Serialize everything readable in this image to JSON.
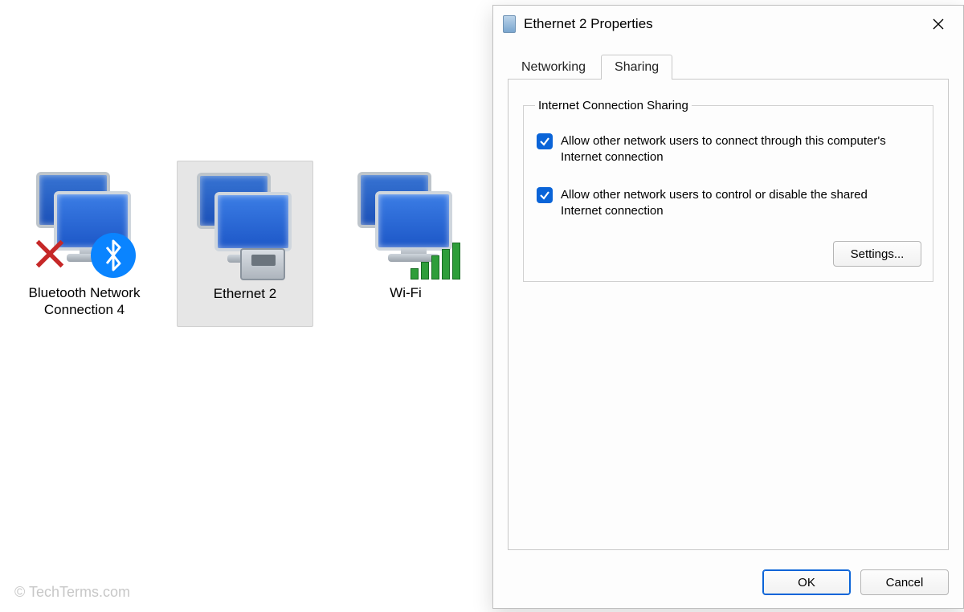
{
  "connections": [
    {
      "label": "Bluetooth Network Connection 4",
      "overlay": "bluetooth-error",
      "selected": false
    },
    {
      "label": "Ethernet 2",
      "overlay": "ethernet",
      "selected": true
    },
    {
      "label": "Wi-Fi",
      "overlay": "wifi",
      "selected": false
    }
  ],
  "dialog": {
    "title": "Ethernet 2 Properties",
    "tabs": {
      "networking": "Networking",
      "sharing": "Sharing",
      "active": "sharing"
    },
    "group_title": "Internet Connection Sharing",
    "allow_connect": {
      "checked": true,
      "label": "Allow other network users to connect through this computer's Internet connection"
    },
    "allow_control": {
      "checked": true,
      "label": "Allow other network users to control or disable the shared Internet connection"
    },
    "settings_btn": "Settings...",
    "ok_btn": "OK",
    "cancel_btn": "Cancel"
  },
  "watermark": "© TechTerms.com"
}
